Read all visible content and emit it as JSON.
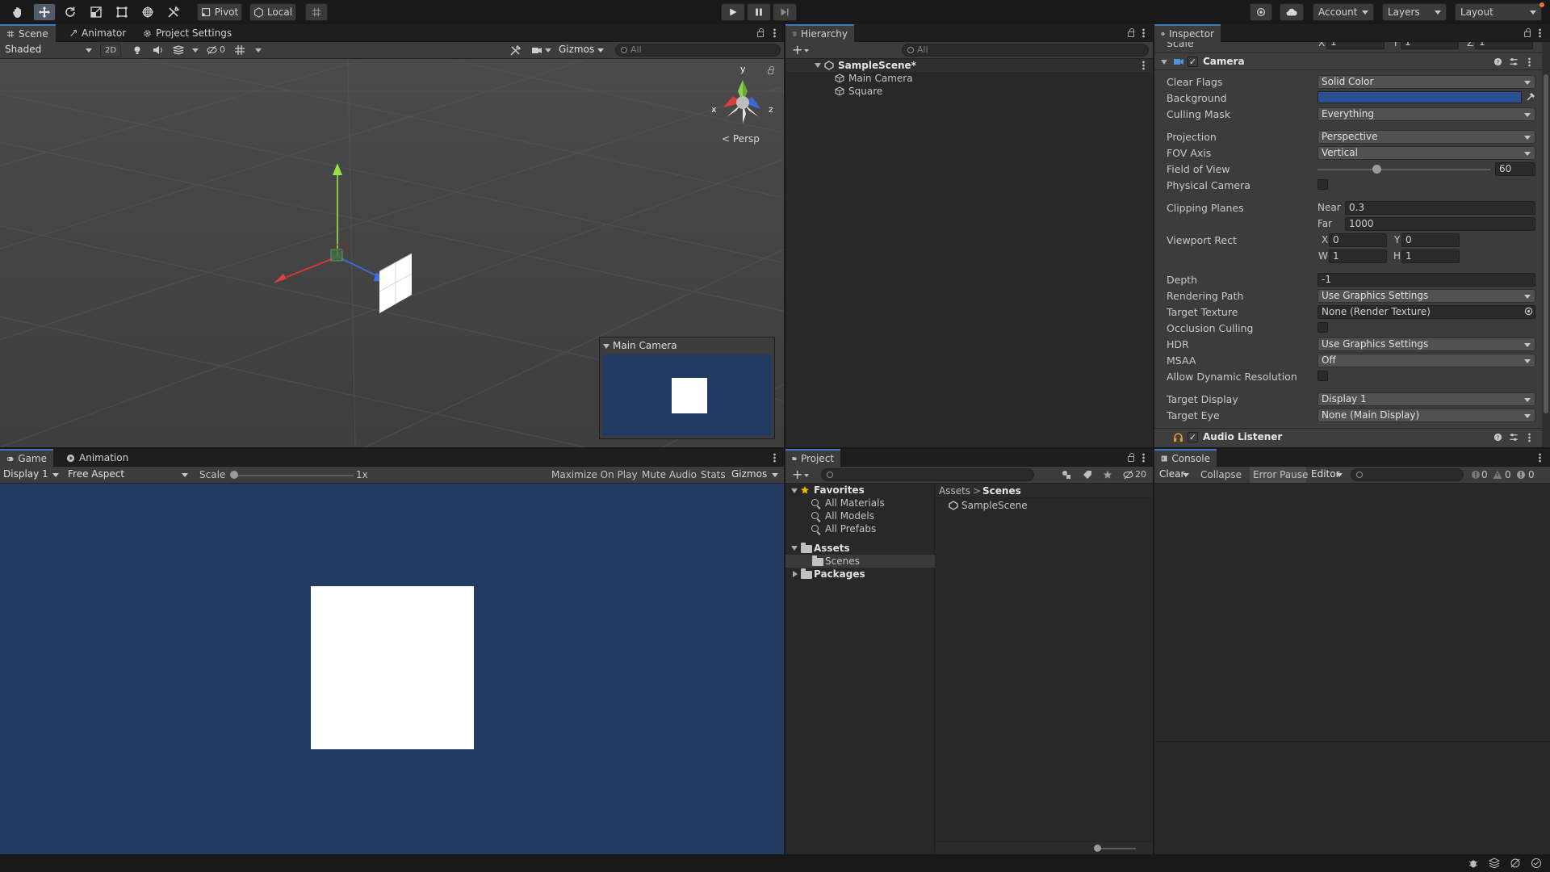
{
  "toolbar": {
    "pivot_label": "Pivot",
    "local_label": "Local",
    "account_label": "Account",
    "layers_label": "Layers",
    "layout_label": "Layout"
  },
  "scene_panel": {
    "tabs": [
      "Scene",
      "Animator",
      "Project Settings"
    ],
    "shading_mode": "Shaded",
    "mode_2d": "2D",
    "hidden_count": "0",
    "gizmos_label": "Gizmos",
    "search_placeholder": "All",
    "persp_label": "Persp",
    "gizmo_axes": {
      "x": "x",
      "y": "y",
      "z": "z"
    },
    "camera_preview_title": "Main Camera"
  },
  "game_panel": {
    "tabs": [
      "Game",
      "Animation"
    ],
    "display": "Display 1",
    "aspect": "Free Aspect",
    "scale_label": "Scale",
    "scale_value": "1x",
    "buttons": [
      "Maximize On Play",
      "Mute Audio",
      "Stats",
      "Gizmos"
    ],
    "background_color": "#233a62"
  },
  "hierarchy": {
    "tab": "Hierarchy",
    "search_placeholder": "All",
    "scene_name": "SampleScene*",
    "objects": [
      "Main Camera",
      "Square"
    ]
  },
  "project": {
    "tab": "Project",
    "hidden_count": "20",
    "favorites_label": "Favorites",
    "favorites": [
      "All Materials",
      "All Models",
      "All Prefabs"
    ],
    "assets_label": "Assets",
    "assets_children": [
      "Scenes"
    ],
    "packages_label": "Packages",
    "breadcrumb": [
      "Assets",
      "Scenes"
    ],
    "files": [
      "SampleScene"
    ]
  },
  "inspector": {
    "tab": "Inspector",
    "scale_label": "Scale",
    "scale": {
      "x_label": "X",
      "x": "1",
      "y_label": "Y",
      "y": "1",
      "z_label": "Z",
      "z": "1"
    },
    "component_title": "Camera",
    "clear_flags_label": "Clear Flags",
    "clear_flags": "Solid Color",
    "background_label": "Background",
    "background_color": "#2a4f93",
    "culling_mask_label": "Culling Mask",
    "culling_mask": "Everything",
    "projection_label": "Projection",
    "projection": "Perspective",
    "fov_axis_label": "FOV Axis",
    "fov_axis": "Vertical",
    "fov_label": "Field of View",
    "fov": "60",
    "fov_slider_fraction": 0.34,
    "physical_camera_label": "Physical Camera",
    "clipping_label": "Clipping Planes",
    "near_label": "Near",
    "near": "0.3",
    "far_label": "Far",
    "far": "1000",
    "viewport_label": "Viewport Rect",
    "viewport": {
      "x_label": "X",
      "x": "0",
      "y_label": "Y",
      "y": "0",
      "w_label": "W",
      "w": "1",
      "h_label": "H",
      "h": "1"
    },
    "depth_label": "Depth",
    "depth": "-1",
    "rendering_path_label": "Rendering Path",
    "rendering_path": "Use Graphics Settings",
    "target_texture_label": "Target Texture",
    "target_texture": "None (Render Texture)",
    "occlusion_label": "Occlusion Culling",
    "hdr_label": "HDR",
    "hdr": "Use Graphics Settings",
    "msaa_label": "MSAA",
    "msaa": "Off",
    "dynamic_res_label": "Allow Dynamic Resolution",
    "target_display_label": "Target Display",
    "target_display": "Display 1",
    "target_eye_label": "Target Eye",
    "target_eye": "None (Main Display)",
    "audio_listener_title": "Audio Listener"
  },
  "console": {
    "tab": "Console",
    "clear_label": "Clear",
    "collapse_label": "Collapse",
    "error_pause_label": "Error Pause",
    "editor_label": "Editor",
    "log_count": "0",
    "warn_count": "0",
    "error_count": "0"
  }
}
